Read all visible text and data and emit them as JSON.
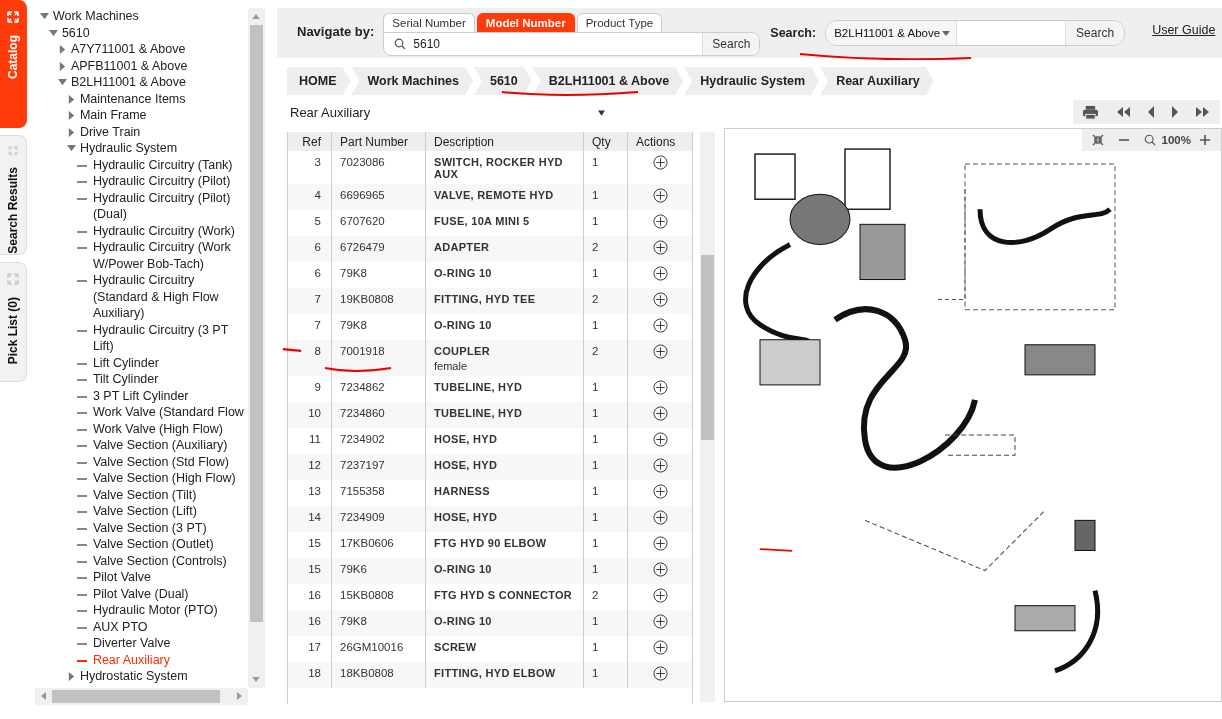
{
  "side_tabs": [
    {
      "label": "Catalog",
      "selected": true
    },
    {
      "label": "Search Results",
      "selected": false
    },
    {
      "label": "Pick List (0)",
      "selected": false
    }
  ],
  "tree": [
    {
      "label": "Work Machines",
      "expanded": true,
      "children": [
        {
          "label": "5610",
          "expanded": true,
          "children": [
            {
              "label": "A7Y711001 & Above",
              "expanded": false
            },
            {
              "label": "APFB11001 & Above",
              "expanded": false
            },
            {
              "label": "B2LH11001 & Above",
              "expanded": true,
              "children": [
                {
                  "label": "Maintenance Items",
                  "expanded": false
                },
                {
                  "label": "Main Frame",
                  "expanded": false
                },
                {
                  "label": "Drive Train",
                  "expanded": false
                },
                {
                  "label": "Hydraulic System",
                  "expanded": true,
                  "children": [
                    {
                      "label": "Hydraulic Circuitry (Tank)",
                      "selected": false
                    },
                    {
                      "label": "Hydraulic Circuitry (Pilot)",
                      "selected": false
                    },
                    {
                      "label": "Hydraulic Circuitry (Pilot) (Dual)",
                      "selected": false
                    },
                    {
                      "label": "Hydraulic Circuitry (Work)",
                      "selected": false
                    },
                    {
                      "label": "Hydraulic Circuitry (Work W/Power Bob-Tach)",
                      "selected": false
                    },
                    {
                      "label": "Hydraulic Circuitry (Standard & High Flow Auxiliary)",
                      "selected": false
                    },
                    {
                      "label": "Hydraulic Circuitry (3 PT Lift)",
                      "selected": false
                    },
                    {
                      "label": "Lift Cylinder",
                      "selected": false
                    },
                    {
                      "label": "Tilt Cylinder",
                      "selected": false
                    },
                    {
                      "label": "3 PT Lift Cylinder",
                      "selected": false
                    },
                    {
                      "label": "Work Valve (Standard Flow",
                      "selected": false
                    },
                    {
                      "label": "Work Valve (High Flow)",
                      "selected": false
                    },
                    {
                      "label": "Valve Section (Auxiliary)",
                      "selected": false
                    },
                    {
                      "label": "Valve Section (Std Flow)",
                      "selected": false
                    },
                    {
                      "label": "Valve Section (High Flow)",
                      "selected": false
                    },
                    {
                      "label": "Valve Section (Tilt)",
                      "selected": false
                    },
                    {
                      "label": "Valve Section (Lift)",
                      "selected": false
                    },
                    {
                      "label": "Valve Section (3 PT)",
                      "selected": false
                    },
                    {
                      "label": "Valve Section (Outlet)",
                      "selected": false
                    },
                    {
                      "label": "Valve Section (Controls)",
                      "selected": false
                    },
                    {
                      "label": "Pilot Valve",
                      "selected": false
                    },
                    {
                      "label": "Pilot Valve (Dual)",
                      "selected": false
                    },
                    {
                      "label": "Hydraulic Motor (PTO)",
                      "selected": false
                    },
                    {
                      "label": "AUX PTO",
                      "selected": false
                    },
                    {
                      "label": "Diverter Valve",
                      "selected": false
                    },
                    {
                      "label": "Rear Auxiliary",
                      "selected": true
                    }
                  ]
                },
                {
                  "label": "Hydrostatic System",
                  "expanded": false
                }
              ]
            }
          ]
        }
      ]
    }
  ],
  "navigate": {
    "label": "Navigate by:",
    "tabs": [
      {
        "label": "Serial Number",
        "selected": false
      },
      {
        "label": "Model Number",
        "selected": true
      },
      {
        "label": "Product Type",
        "selected": false
      }
    ],
    "value": "5610",
    "button": "Search"
  },
  "search": {
    "label": "Search:",
    "scope": "B2LH11001 & Above",
    "button": "Search"
  },
  "user_guide": "User Guide",
  "breadcrumb": [
    "HOME",
    "Work Machines",
    "5610",
    "B2LH11001 & Above",
    "Hydraulic System",
    "Rear Auxiliary"
  ],
  "section_select": "Rear Auxiliary",
  "table": {
    "columns": [
      "Ref",
      "Part Number",
      "Description",
      "Qty",
      "Actions"
    ],
    "rows": [
      {
        "ref": "3",
        "part": "7023086",
        "description": "SWITCH, ROCKER HYD AUX",
        "qty": "1"
      },
      {
        "ref": "4",
        "part": "6696965",
        "description": "VALVE, REMOTE HYD",
        "qty": "1"
      },
      {
        "ref": "5",
        "part": "6707620",
        "description": "FUSE, 10A MINI 5",
        "qty": "1"
      },
      {
        "ref": "6",
        "part": "6726479",
        "description": "ADAPTER",
        "qty": "2"
      },
      {
        "ref": "6",
        "part": "79K8",
        "description": "O-RING 10",
        "qty": "1"
      },
      {
        "ref": "7",
        "part": "19KB0808",
        "description": "FITTING, HYD TEE",
        "qty": "2"
      },
      {
        "ref": "7",
        "part": "79K8",
        "description": "O-RING 10",
        "qty": "1"
      },
      {
        "ref": "8",
        "part": "7001918",
        "description": "COUPLER",
        "note": "female",
        "qty": "2"
      },
      {
        "ref": "9",
        "part": "7234862",
        "description": "TUBELINE, HYD",
        "qty": "1"
      },
      {
        "ref": "10",
        "part": "7234860",
        "description": "TUBELINE, HYD",
        "qty": "1"
      },
      {
        "ref": "11",
        "part": "7234902",
        "description": "HOSE, HYD",
        "qty": "1"
      },
      {
        "ref": "12",
        "part": "7237197",
        "description": "HOSE, HYD",
        "qty": "1"
      },
      {
        "ref": "13",
        "part": "7155358",
        "description": "HARNESS",
        "qty": "1"
      },
      {
        "ref": "14",
        "part": "7234909",
        "description": "HOSE, HYD",
        "qty": "1"
      },
      {
        "ref": "15",
        "part": "17KB0606",
        "description": "FTG HYD 90 ELBOW",
        "qty": "1"
      },
      {
        "ref": "15",
        "part": "79K6",
        "description": "O-RING 10",
        "qty": "1"
      },
      {
        "ref": "16",
        "part": "15KB0808",
        "description": "FTG HYD S CONNECTOR",
        "qty": "2"
      },
      {
        "ref": "16",
        "part": "79K8",
        "description": "O-RING 10",
        "qty": "1"
      },
      {
        "ref": "17",
        "part": "26GM10016",
        "description": "SCREW",
        "qty": "1"
      },
      {
        "ref": "18",
        "part": "18KB0808",
        "description": "FITTING, HYD ELBOW",
        "qty": "1"
      }
    ]
  },
  "viewer": {
    "zoom": "100%",
    "diagram": {
      "kind": "picture"
    }
  }
}
